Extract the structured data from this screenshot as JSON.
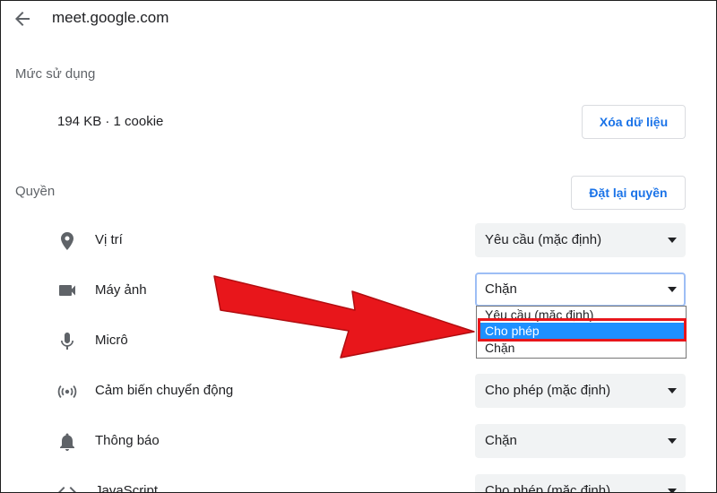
{
  "header": {
    "site": "meet.google.com"
  },
  "usage": {
    "title": "Mức sử dụng",
    "value": "194 KB · 1 cookie",
    "clear_button": "Xóa dữ liệu"
  },
  "permissions": {
    "title": "Quyền",
    "reset_button": "Đặt lại quyền",
    "items": [
      {
        "label": "Vị trí",
        "icon": "location-icon",
        "value": "Yêu cầu (mặc định)"
      },
      {
        "label": "Máy ảnh",
        "icon": "camera-icon",
        "value": "Chặn"
      },
      {
        "label": "Micrô",
        "icon": "microphone-icon",
        "value": ""
      },
      {
        "label": "Cảm biến chuyển động",
        "icon": "motion-sensor-icon",
        "value": "Cho phép (mặc định)"
      },
      {
        "label": "Thông báo",
        "icon": "bell-icon",
        "value": "Chặn"
      },
      {
        "label": "JavaScript",
        "icon": "code-icon",
        "value": "Cho phép (mặc định)"
      }
    ]
  },
  "dropdown": {
    "options": [
      "Yêu cầu (mặc định)",
      "Cho phép",
      "Chặn"
    ],
    "highlighted": "Cho phép"
  },
  "colors": {
    "accent": "#1a73e8",
    "highlight": "#1e90ff",
    "annotation_red": "#e8161b"
  }
}
